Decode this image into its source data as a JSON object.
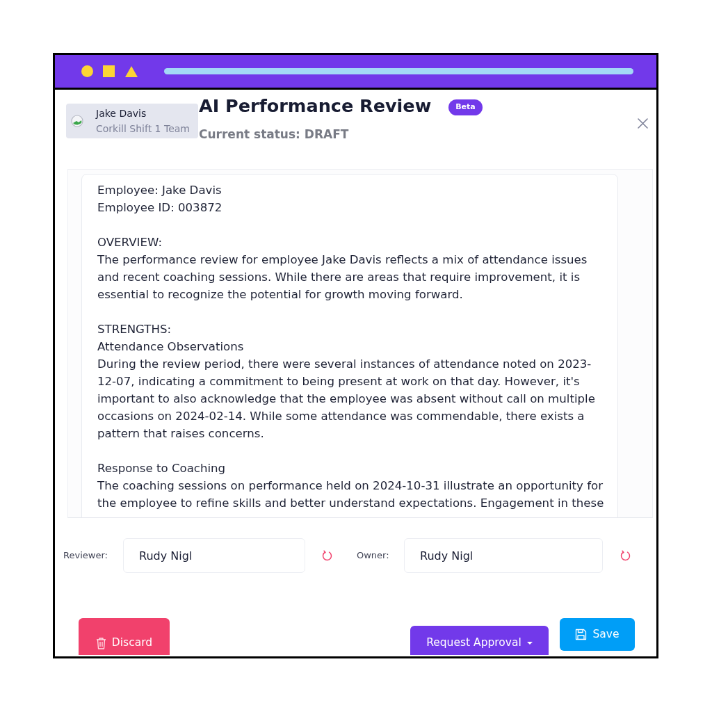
{
  "employee_chip": {
    "name": "Jake Davis",
    "team": "Corkill Shift 1 Team"
  },
  "header": {
    "title": "AI Performance Review",
    "badge": "Beta",
    "status": "Current status: DRAFT"
  },
  "review": {
    "blocks": [
      [
        "Employee: Jake Davis",
        "Employee ID: 003872"
      ],
      [
        "OVERVIEW:",
        "The performance review for employee Jake Davis reflects a mix of attendance issues and recent coaching sessions. While there are areas that require improvement, it is essential to recognize the potential for growth moving forward."
      ],
      [
        "STRENGTHS:",
        "Attendance Observations",
        "During the review period, there were several instances of attendance noted on 2023-12-07, indicating a commitment to being present at work on that day. However, it's important to also acknowledge that the employee was absent without call on multiple occasions on 2024-02-14. While some attendance was commendable, there exists a pattern that raises concerns."
      ],
      [
        "Response to Coaching",
        "The coaching sessions on performance held on 2024-10-31 illustrate an opportunity for the employee to refine skills and better understand expectations. Engagement in these"
      ]
    ]
  },
  "assignments": [
    {
      "label": "Reviewer:",
      "value": "Rudy Nigl"
    },
    {
      "label": "Owner:",
      "value": "Rudy Nigl"
    }
  ],
  "actions": [
    {
      "kind": "discard",
      "label": "Discard"
    },
    {
      "kind": "request",
      "label": "Request Approval"
    },
    {
      "kind": "save",
      "label": "Save"
    }
  ]
}
